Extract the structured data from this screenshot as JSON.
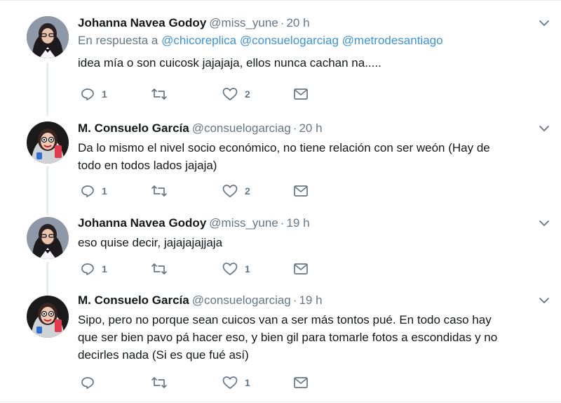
{
  "tweets": [
    {
      "name": "Johanna Navea Godoy",
      "handle": "@miss_yune",
      "dot": "·",
      "time": "20 h",
      "reply_prefix": "En respuesta a",
      "reply_mentions": [
        "@chicoreplica",
        "@consuelogarciag",
        "@metrodesantiago"
      ],
      "text": "idea mía o son cuicosk jajajaja, ellos nunca cachan na.....",
      "replies": "1",
      "retweets": "",
      "likes": "2",
      "avatar": "avatar-johanna"
    },
    {
      "name": "M. Consuelo García",
      "handle": "@consuelogarciag",
      "dot": "·",
      "time": "20 h",
      "text_lines": [
        "Da lo mismo el nivel socio económico, no tiene relación con ser weón (Hay de",
        "todo en todos lados jajaja)"
      ],
      "replies": "1",
      "retweets": "",
      "likes": "2",
      "avatar": "avatar-consuelo"
    },
    {
      "name": "Johanna Navea Godoy",
      "handle": "@miss_yune",
      "dot": "·",
      "time": "19 h",
      "text": "eso quise decir, jajajajajjaja",
      "replies": "1",
      "retweets": "",
      "likes": "1",
      "avatar": "avatar-johanna"
    },
    {
      "name": "M. Consuelo García",
      "handle": "@consuelogarciag",
      "dot": "·",
      "time": "19 h",
      "text_lines": [
        "Sipo, pero no porque sean cuicos van a ser más tontos pué. En todo caso hay",
        "que ser bien pavo pá hacer eso, y bien gil para tomarle fotos a escondidas y no",
        "decirles nada (Si es que fué así)"
      ],
      "replies": "",
      "retweets": "",
      "likes": "1",
      "avatar": "avatar-consuelo"
    }
  ],
  "colors": {
    "name": "#14171a",
    "muted": "#657786",
    "mention": "#3b94d9",
    "thread_line": "#e6ecf0"
  },
  "icons": {
    "reply": "reply-icon",
    "retweet": "retweet-icon",
    "like": "heart-icon",
    "dm": "envelope-icon",
    "menu": "chevron-down-icon"
  }
}
